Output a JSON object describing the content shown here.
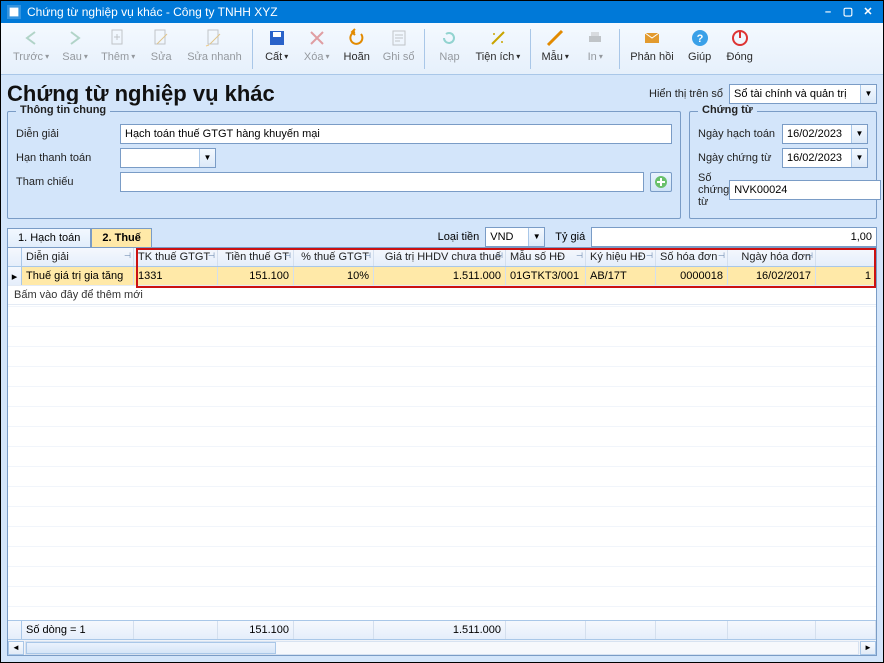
{
  "title": "Chứng từ nghiệp vụ khác - Công ty TNHH XYZ",
  "toolbar": {
    "prev": "Trước",
    "next": "Sau",
    "add": "Thêm",
    "edit": "Sửa",
    "quickedit": "Sửa nhanh",
    "save": "Cất",
    "delete": "Xóa",
    "undo": "Hoãn",
    "post": "Ghi sổ",
    "load": "Nạp",
    "util": "Tiện ích",
    "template": "Mẫu",
    "print": "In",
    "feedback": "Phản hồi",
    "help": "Giúp",
    "close": "Đóng"
  },
  "heading": "Chứng từ nghiệp vụ khác",
  "display_on_label": "Hiển thị trên sổ",
  "display_on_value": "Sổ tài chính và quản trị",
  "general": {
    "legend": "Thông tin chung",
    "desc_label": "Diễn giải",
    "desc_value": "Hạch toán thuế GTGT hàng khuyến mại",
    "due_label": "Hạn thanh toán",
    "due_value": "",
    "ref_label": "Tham chiếu",
    "ref_value": ""
  },
  "voucher": {
    "legend": "Chứng từ",
    "acc_date_label": "Ngày hạch toán",
    "acc_date_value": "16/02/2023",
    "vou_date_label": "Ngày chứng từ",
    "vou_date_value": "16/02/2023",
    "no_label": "Số chứng từ",
    "no_value": "NVK00024"
  },
  "tabs": {
    "t1": "1. Hạch toán",
    "t2": "2. Thuế"
  },
  "currency": {
    "label": "Loại tiền",
    "value": "VND",
    "rate_label": "Tỷ giá",
    "rate_value": "1,00"
  },
  "grid": {
    "cols": [
      "Diễn giải",
      "TK thuế GTGT",
      "Tiền thuế GT",
      "% thuế GTGT",
      "Giá trị HHDV chưa thuế",
      "Mẫu số HĐ",
      "Ký hiệu HĐ",
      "Số hóa đơn",
      "Ngày hóa đơn"
    ],
    "row": {
      "desc": "Thuế giá trị gia tăng",
      "acc": "1331",
      "tax": "151.100",
      "pct": "10%",
      "base": "1.511.000",
      "form": "01GTKT3/001",
      "serial": "AB/17T",
      "invno": "0000018",
      "invdate": "16/02/2017",
      "extra": "1"
    },
    "hint": "Bấm vào đây để thêm mới",
    "footer": {
      "rows_label": "Số dòng = 1",
      "tax_total": "151.100",
      "base_total": "1.511.000"
    }
  }
}
